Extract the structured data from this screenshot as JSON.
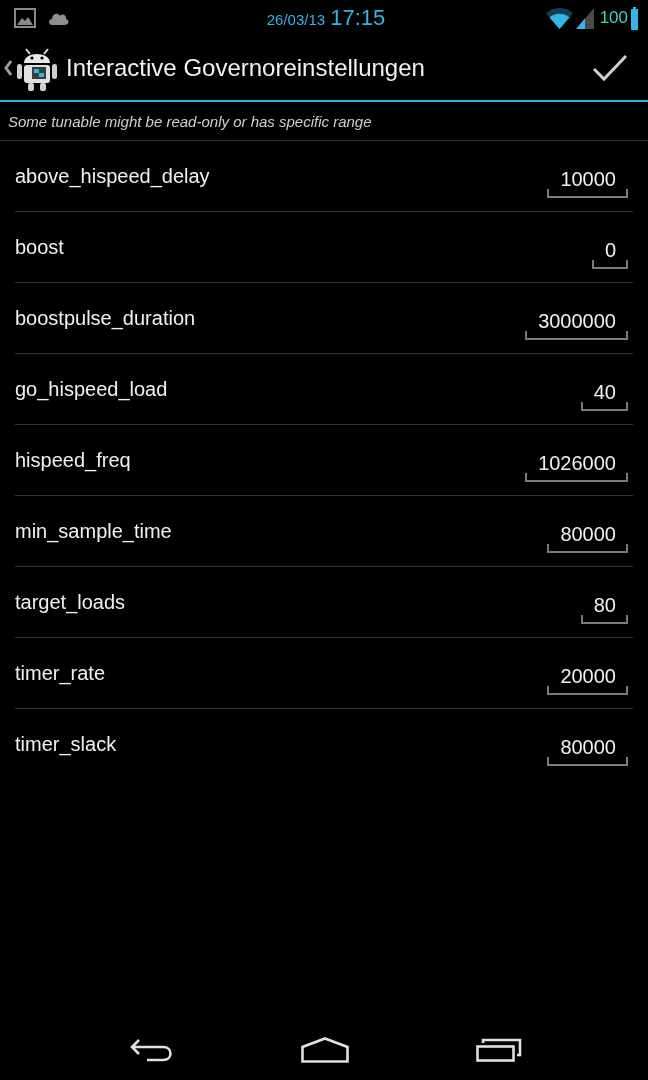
{
  "status_bar": {
    "date": "26/03/13",
    "time": "17:15",
    "battery_percent": "100"
  },
  "action_bar": {
    "title": "Interactive Governoreinstellungen"
  },
  "notice": "Some tunable might be read-only or has specific range",
  "tunables": [
    {
      "name": "above_hispeed_delay",
      "value": "10000"
    },
    {
      "name": "boost",
      "value": "0"
    },
    {
      "name": "boostpulse_duration",
      "value": "3000000"
    },
    {
      "name": "go_hispeed_load",
      "value": "40"
    },
    {
      "name": "hispeed_freq",
      "value": "1026000"
    },
    {
      "name": "min_sample_time",
      "value": "80000"
    },
    {
      "name": "target_loads",
      "value": "80"
    },
    {
      "name": "timer_rate",
      "value": "20000"
    },
    {
      "name": "timer_slack",
      "value": "80000"
    }
  ]
}
